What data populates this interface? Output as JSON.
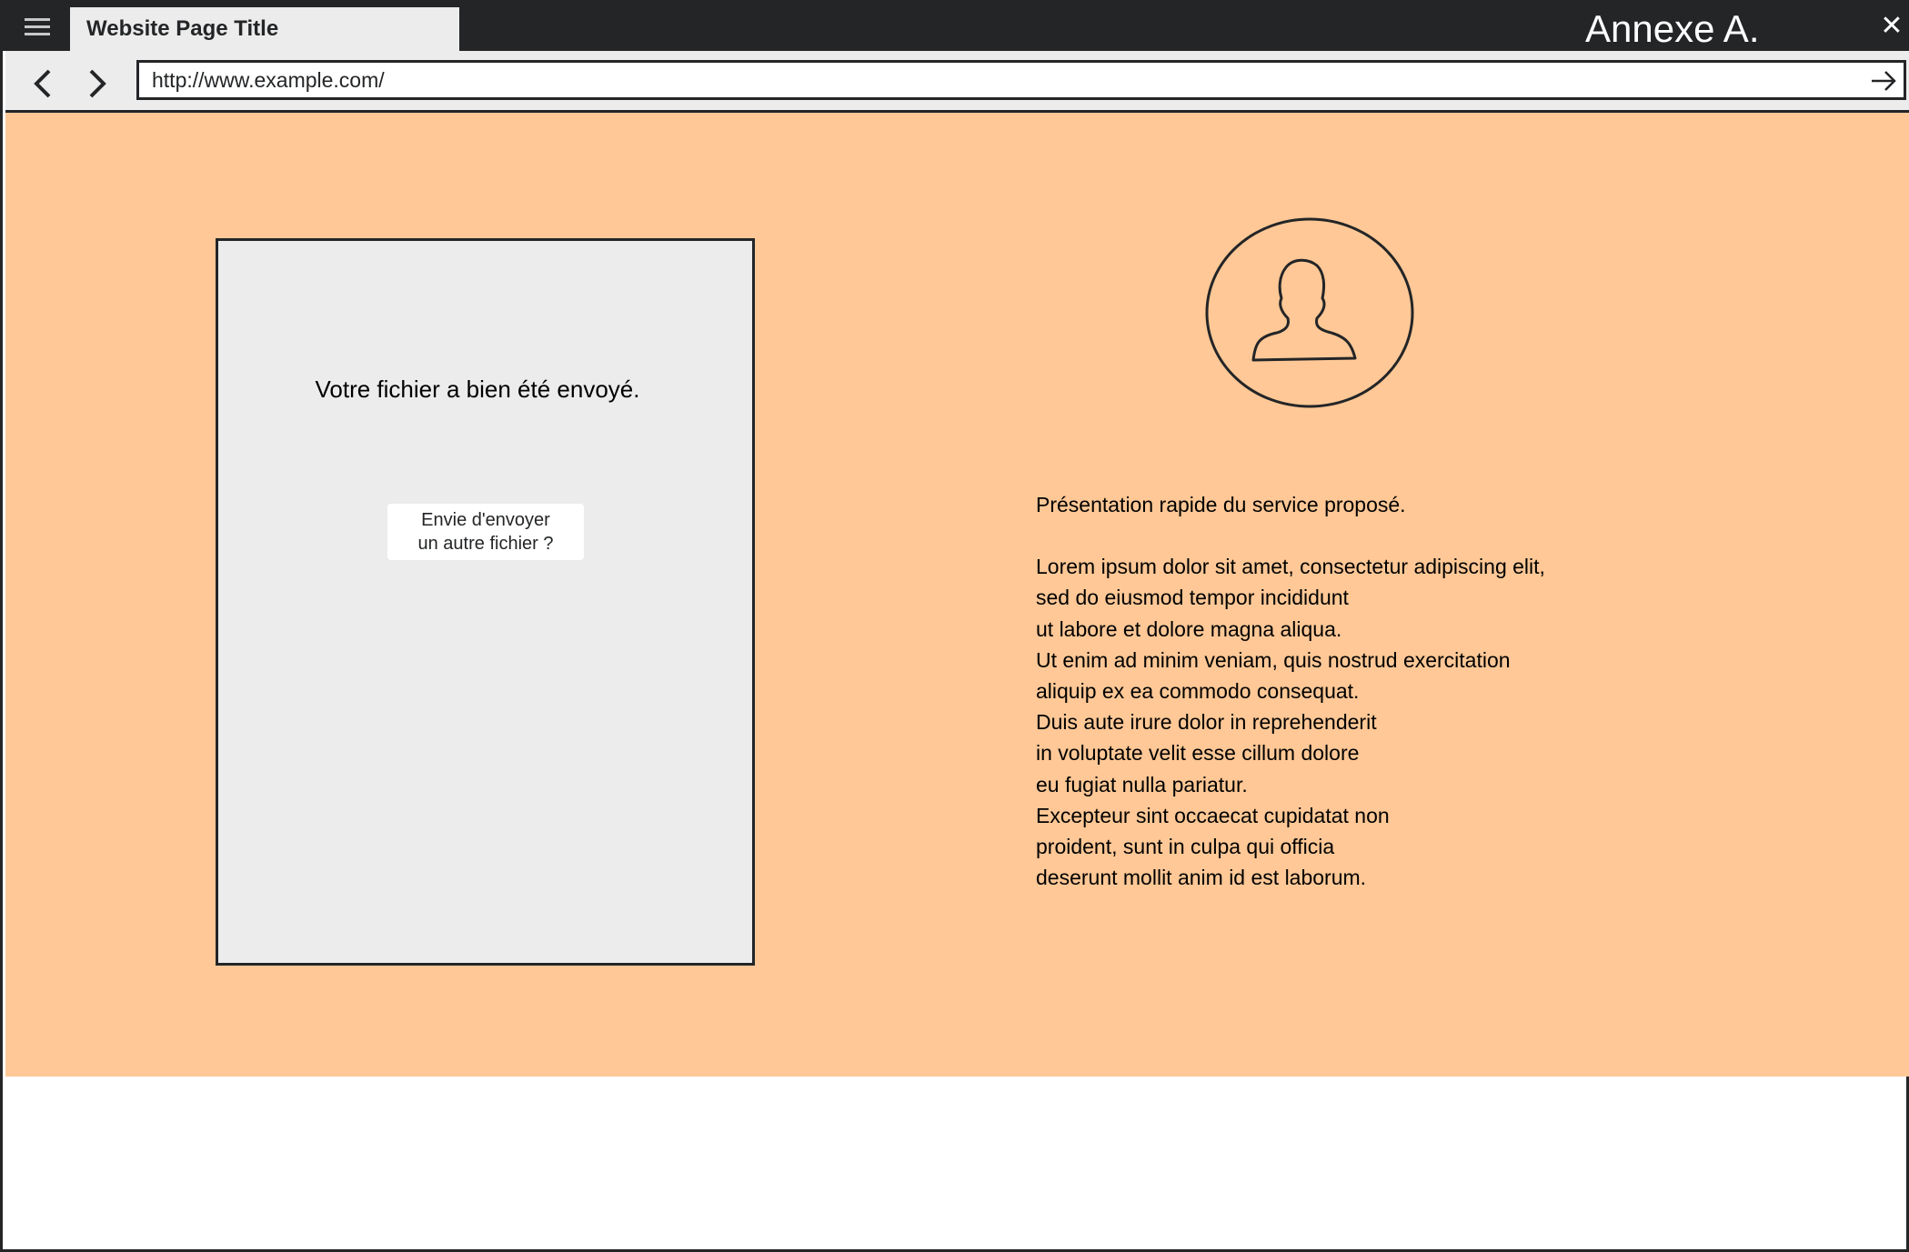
{
  "browser": {
    "tab_title": "Website Page Title",
    "heading_right": "Annexe A.",
    "close_symbol": "✕",
    "url": "http://www.example.com/"
  },
  "card": {
    "message": "Votre fichier a bien été envoyé.",
    "button_line1": "Envie d'envoyer",
    "button_line2": "un autre fichier ?"
  },
  "description": {
    "intro": "Présentation rapide du service proposé.",
    "lines": [
      "Lorem ipsum dolor sit amet, consectetur adipiscing elit,",
      "sed do eiusmod tempor incididunt",
      "ut labore et dolore magna aliqua.",
      "Ut enim ad minim veniam, quis nostrud exercitation",
      "aliquip ex ea commodo consequat.",
      "Duis aute irure dolor in reprehenderit",
      "in voluptate velit esse cillum dolore",
      "eu fugiat nulla pariatur.",
      "Excepteur sint occaecat cupidatat non",
      "proident, sunt in culpa qui officia",
      "deserunt mollit anim id est laborum."
    ]
  },
  "icons": {
    "menu": "hamburger-menu-icon",
    "back": "chevron-left-icon",
    "forward": "chevron-right-icon",
    "go": "arrow-right-icon",
    "close": "close-icon",
    "avatar": "user-avatar-icon"
  },
  "colors": {
    "chrome": "#232527",
    "tab": "#ececec",
    "content_background": "#ffc896",
    "card_background": "#ececec"
  }
}
